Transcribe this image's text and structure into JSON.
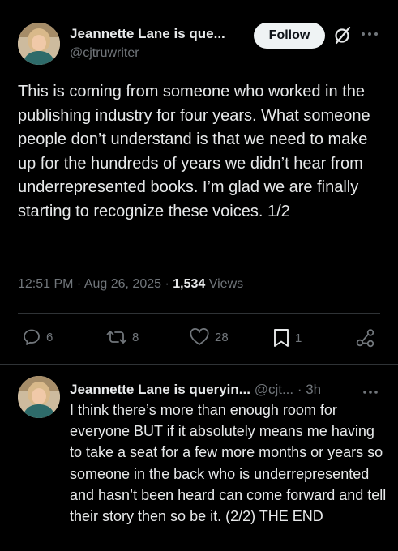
{
  "author": {
    "name": "Jeannette Lane is que...",
    "handle": "@cjtruwriter"
  },
  "header": {
    "follow_label": "Follow"
  },
  "tweet": {
    "text": "This is coming from someone who worked in the publishing industry for four years. What someone people don’t understand is that we need to make up for the hundreds of years we didn’t hear from underrepresented books. I’m glad we are finally starting to recognize these voices. 1/2",
    "time": "12:51 PM · Aug 26, 2025 · ",
    "views_count": "1,534",
    "views_label": " Views"
  },
  "actions": {
    "replies": "6",
    "reposts": "8",
    "likes": "28",
    "bookmarks": "1"
  },
  "reply": {
    "name": "Jeannette Lane is queryin...",
    "meta": " @cjt... · 3h",
    "text": "I think there’s more than enough room for everyone BUT if it absolutely means me having to take a seat for a few more months or years so someone in the back who is underrepresented and hasn’t been heard can come forward and tell their story then so be it. (2/2) THE END"
  },
  "icons": {
    "grok": "grok-icon",
    "more": "more-icon",
    "reply": "reply-icon",
    "repost": "repost-icon",
    "like": "heart-icon",
    "bookmark": "bookmark-icon",
    "share": "share-icon"
  },
  "colors": {
    "background": "#000000",
    "text": "#e7e9ea",
    "secondary": "#71767b",
    "divider": "#2f3336",
    "follow_bg": "#eff3f4"
  }
}
